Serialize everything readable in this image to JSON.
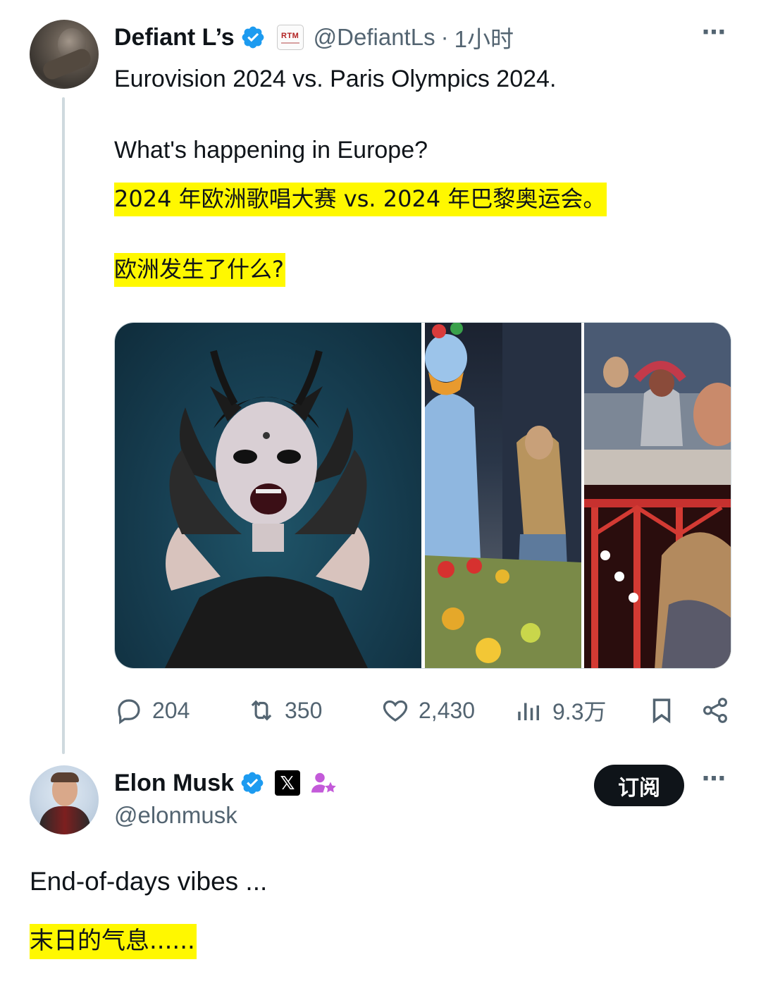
{
  "tweet": {
    "author": {
      "display_name": "Defiant L’s",
      "handle": "@DefiantLs",
      "separator": "·",
      "time": "1小时",
      "affiliate_badge": "RTM"
    },
    "lines": [
      "Eurovision 2024 vs. Paris Olympics 2024.",
      "What's happening in Europe?",
      "2024 年欧洲歌唱大赛 vs. 2024 年巴黎奥运会。",
      "欧洲发生了什么?"
    ],
    "more_icon": "⋯",
    "stats": {
      "replies": "204",
      "reposts": "350",
      "likes": "2,430",
      "views": "9.3万"
    }
  },
  "reply": {
    "author": {
      "display_name": "Elon Musk",
      "handle": "@elonmusk",
      "x_badge": "𝕏"
    },
    "subscribe_label": "订阅",
    "more_icon": "⋯",
    "text": "End-of-days vibes ...",
    "translation": "末日的气息......"
  },
  "colors": {
    "verified": "#1d9bf0",
    "muted": "#536471",
    "highlight": "#fff800",
    "subscribe_bg": "#0f1419"
  },
  "icons": [
    "verified-icon",
    "reply-icon",
    "repost-icon",
    "like-icon",
    "views-icon",
    "bookmark-icon",
    "share-icon",
    "more-icon",
    "subscriber-badge-icon"
  ]
}
